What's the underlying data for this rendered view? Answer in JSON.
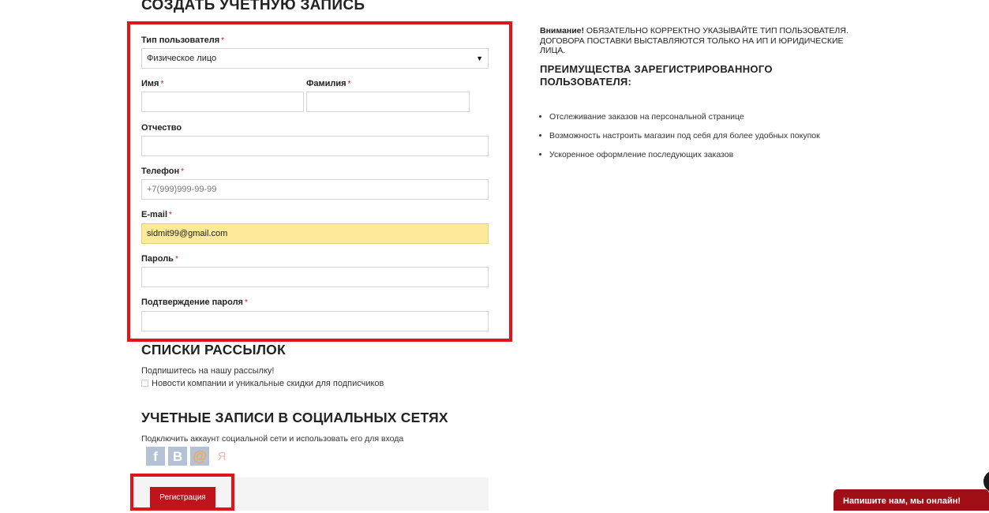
{
  "page": {
    "title": "СОЗДАТЬ УЧЕТНУЮ ЗАПИСЬ"
  },
  "form": {
    "required_mark": "*",
    "user_type": {
      "label": "Тип пользователя",
      "value": "Физическое лицо"
    },
    "first_name": {
      "label": "Имя",
      "value": ""
    },
    "last_name": {
      "label": "Фамилия",
      "value": ""
    },
    "middle_name": {
      "label": "Отчество",
      "value": ""
    },
    "phone": {
      "label": "Телефон",
      "placeholder": "+7(999)999-99-99"
    },
    "email": {
      "label": "E-mail",
      "value": "sidmit99@gmail.com"
    },
    "password": {
      "label": "Пароль",
      "value": ""
    },
    "password_confirm": {
      "label": "Подтверждение пароля",
      "value": ""
    }
  },
  "sidebar": {
    "notice_bold": "Внимание!",
    "notice_text": " ОБЯЗАТЕЛЬНО КОРРЕКТНО УКАЗЫВАЙТЕ ТИП ПОЛЬЗОВАТЕЛЯ. ДОГОВОРА ПОСТАВКИ ВЫСТАВЛЯЮТСЯ ТОЛЬКО НА ИП И ЮРИДИЧЕСКИЕ ЛИЦА.",
    "benefits_title": "ПРЕИМУЩЕСТВА ЗАРЕГИСТРИРОВАННОГО ПОЛЬЗОВАТЕЛЯ:",
    "benefits": [
      "Отслеживание заказов на персональной странице",
      "Возможность настроить магазин под себя для более удобных покупок",
      "Ускоренное оформление последующих заказов"
    ]
  },
  "mailing": {
    "title": "СПИСКИ РАССЫЛОК",
    "subscribe_text": "Подпишитесь на нашу рассылку!",
    "checkbox_label": "Новости компании и уникальные скидки для подписчиков"
  },
  "social": {
    "title": "УЧЕТНЫЕ ЗАПИСИ В СОЦИАЛЬНЫХ СЕТЯХ",
    "text": "Подключить аккаунт социальной сети и использовать его для входа",
    "icons": [
      {
        "name": "facebook-icon",
        "glyph": "f"
      },
      {
        "name": "vkontakte-icon",
        "glyph": "B"
      },
      {
        "name": "mailru-icon",
        "glyph": "@"
      },
      {
        "name": "yandex-icon",
        "glyph": "Я"
      }
    ]
  },
  "actions": {
    "register_label": "Регистрация"
  },
  "chat": {
    "label": "Напишите нам, мы онлайн!"
  },
  "colors": {
    "accent": "#c0141c",
    "highlight_box": "#e3121b",
    "autofill": "#fde99a"
  }
}
